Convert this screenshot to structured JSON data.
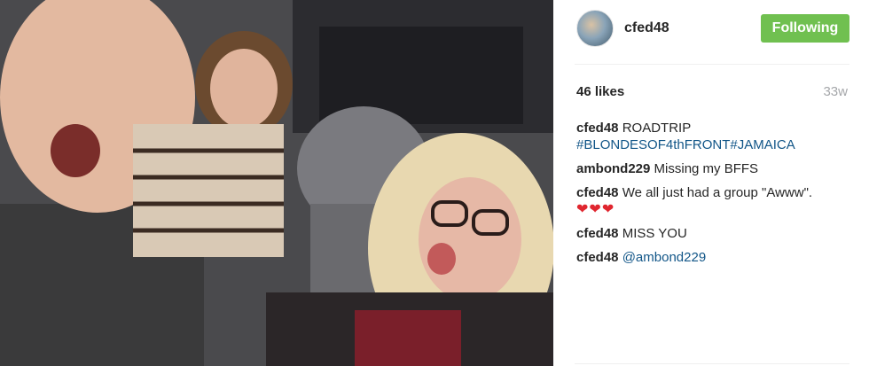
{
  "post": {
    "username": "cfed48",
    "follow_label": "Following",
    "likes": "46 likes",
    "age": "33w",
    "colors": {
      "follow_bg": "#70c050",
      "link": "#125688"
    }
  },
  "comments": [
    {
      "author": "cfed48",
      "text": "ROADTRIP",
      "hashtag": "#BLONDESOF4thFRONT#JAMAICA"
    },
    {
      "author": "ambond229",
      "text": "Missing my BFFS"
    },
    {
      "author": "cfed48",
      "text": "We all just had a group \"Awww\".",
      "emoji": "❤❤❤"
    },
    {
      "author": "cfed48",
      "text": "MISS YOU"
    },
    {
      "author": "cfed48",
      "mention": "@ambond229"
    }
  ]
}
